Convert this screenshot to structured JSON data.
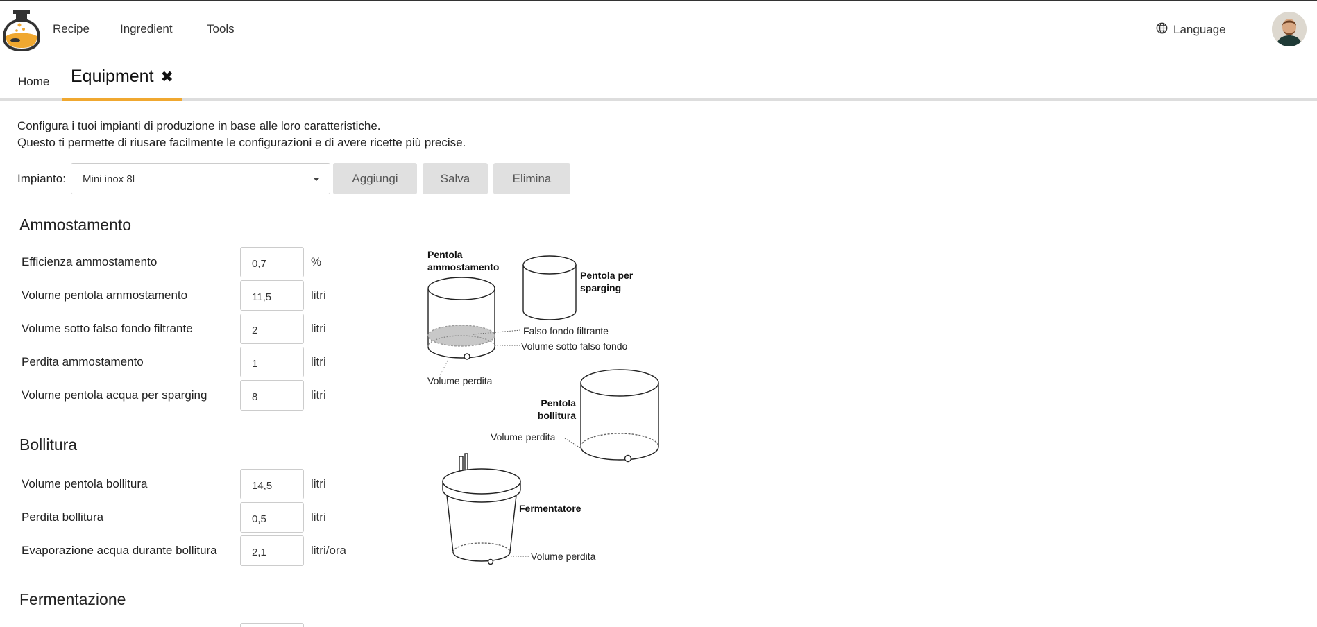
{
  "nav": {
    "items": [
      "Recipe",
      "Ingredient",
      "Tools"
    ],
    "language_label": "Language"
  },
  "tabs": {
    "home": "Home",
    "active": "Equipment"
  },
  "description": {
    "line1": "Configura i tuoi impianti di produzione in base alle loro caratteristiche.",
    "line2": "Questo ti permette di riusare facilmente le configurazioni e di avere ricette più precise."
  },
  "impianto": {
    "label": "Impianto:",
    "selected": "Mini inox 8l",
    "buttons": {
      "add": "Aggiungi",
      "save": "Salva",
      "delete": "Elimina"
    }
  },
  "sections": {
    "mash": {
      "title": "Ammostamento",
      "rows": [
        {
          "label": "Efficienza ammostamento",
          "value": "0,7",
          "unit": "%"
        },
        {
          "label": "Volume pentola ammostamento",
          "value": "11,5",
          "unit": "litri"
        },
        {
          "label": "Volume sotto falso fondo filtrante",
          "value": "2",
          "unit": "litri"
        },
        {
          "label": "Perdita ammostamento",
          "value": "1",
          "unit": "litri"
        },
        {
          "label": "Volume pentola acqua per sparging",
          "value": "8",
          "unit": "litri"
        }
      ]
    },
    "boil": {
      "title": "Bollitura",
      "rows": [
        {
          "label": "Volume pentola bollitura",
          "value": "14,5",
          "unit": "litri"
        },
        {
          "label": "Perdita bollitura",
          "value": "0,5",
          "unit": "litri"
        },
        {
          "label": "Evaporazione acqua durante bollitura",
          "value": "2,1",
          "unit": "litri/ora"
        }
      ]
    },
    "ferment": {
      "title": "Fermentazione"
    }
  },
  "diagram": {
    "mash_pot": [
      "Pentola",
      "ammostamento"
    ],
    "sparge_pot": [
      "Pentola per",
      "sparging"
    ],
    "false_bottom": "Falso fondo filtrante",
    "under_false_bottom": "Volume sotto falso fondo",
    "mash_loss": "Volume perdita",
    "boil_pot": [
      "Pentola",
      "bollitura"
    ],
    "boil_loss": "Volume perdita",
    "fermenter": "Fermentatore",
    "ferm_loss": "Volume perdita"
  },
  "colors": {
    "accent": "#f0a830",
    "button_bg": "#e0e0e0"
  }
}
